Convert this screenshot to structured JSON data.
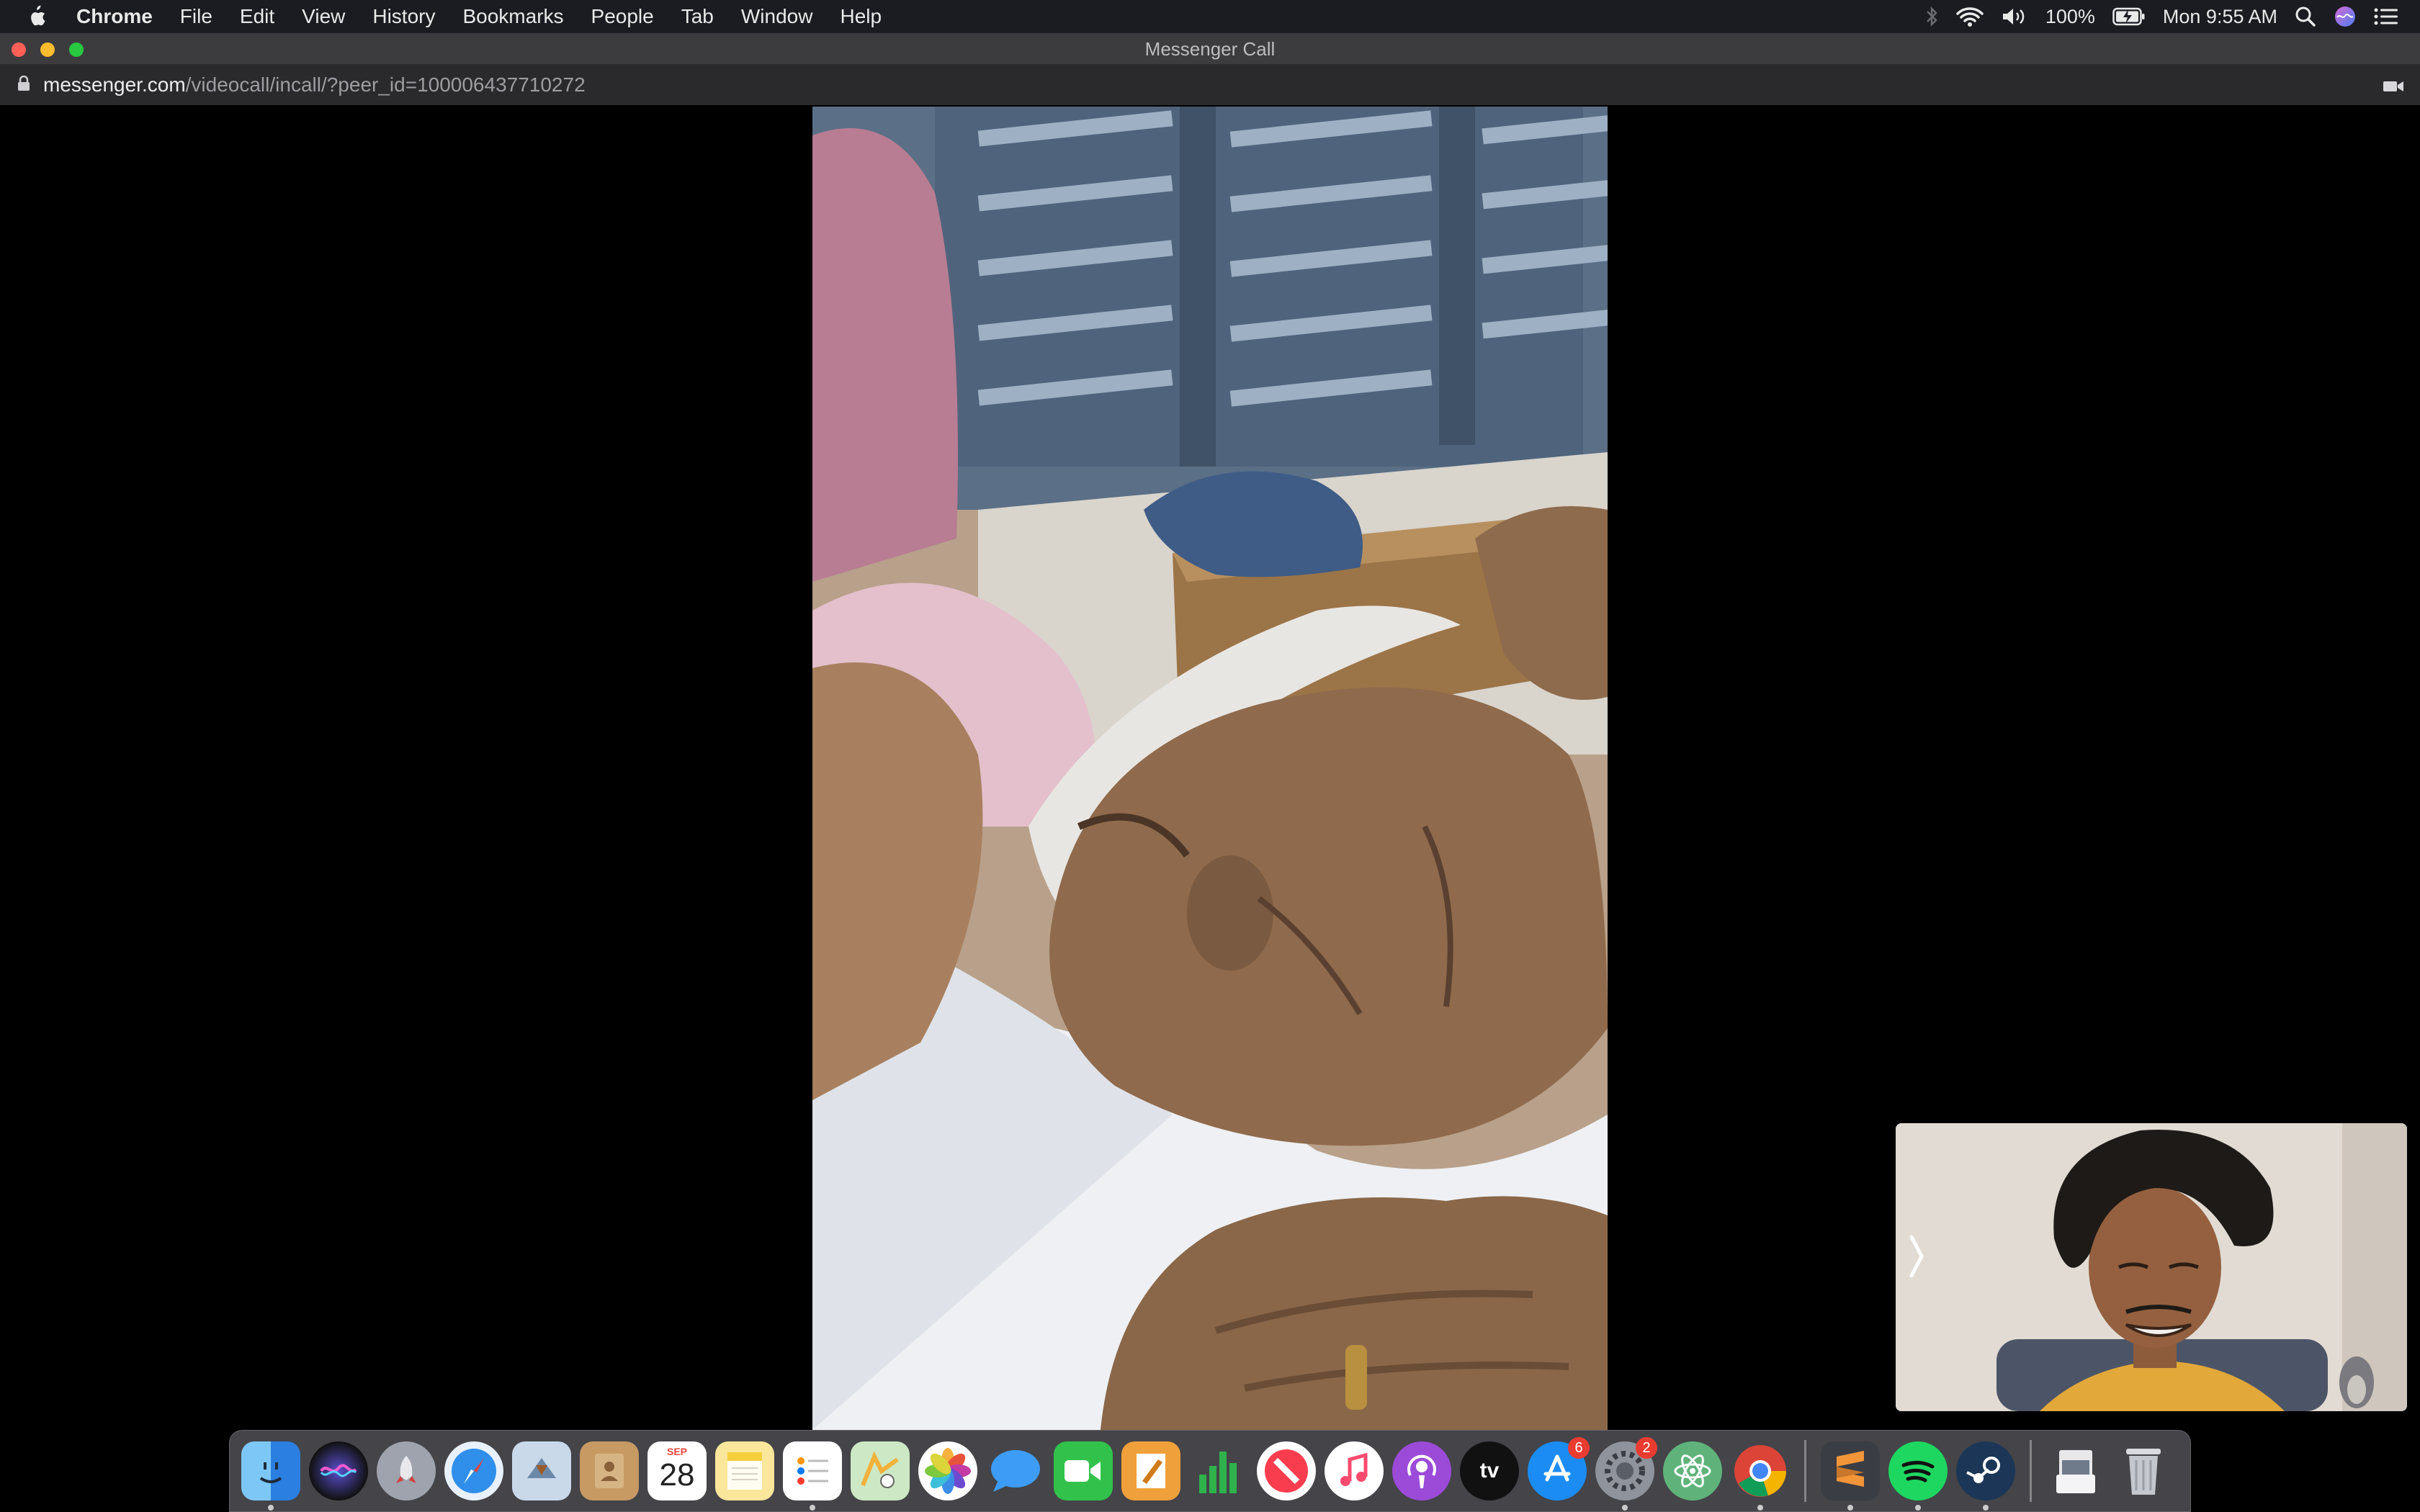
{
  "menubar": {
    "app_name": "Chrome",
    "items": [
      "File",
      "Edit",
      "View",
      "History",
      "Bookmarks",
      "People",
      "Tab",
      "Window",
      "Help"
    ],
    "battery": "100%",
    "clock": "Mon 9:55 AM",
    "status_icons": [
      "bluetooth-icon",
      "wifi-icon",
      "volume-icon",
      "battery-icon",
      "spotlight-icon",
      "siri-icon",
      "notification-center-icon"
    ]
  },
  "window": {
    "title": "Messenger Call"
  },
  "url": {
    "domain": "messenger.com",
    "path": "/videocall/incall/?peer_id=100006437710272"
  },
  "call": {
    "remote_video": "remote participant video feed",
    "self_view": "self camera preview"
  },
  "dock": {
    "apps": [
      "Finder",
      "Siri",
      "Launchpad",
      "Safari",
      "Mail",
      "Contacts",
      "Calendar",
      "Notes",
      "Reminders",
      "Maps",
      "Photos",
      "Messages",
      "FaceTime",
      "Pages",
      "Numbers",
      "News",
      "Music",
      "Podcasts",
      "TV",
      "App Store",
      "System Preferences",
      "Atom",
      "Chrome",
      "Sublime Text",
      "Spotify",
      "Steam",
      "Downloads",
      "Trash"
    ],
    "calendar_month": "SEP",
    "calendar_day": "28",
    "appstore_badge": "6",
    "sysprefs_badge": "2",
    "tv_label": "tv"
  },
  "colors": {
    "menubar_bg": "#1b1c21",
    "titlebar_bg": "#3c3c3f",
    "urlbar_bg": "#2a2a2d",
    "call_bg": "#000000"
  }
}
